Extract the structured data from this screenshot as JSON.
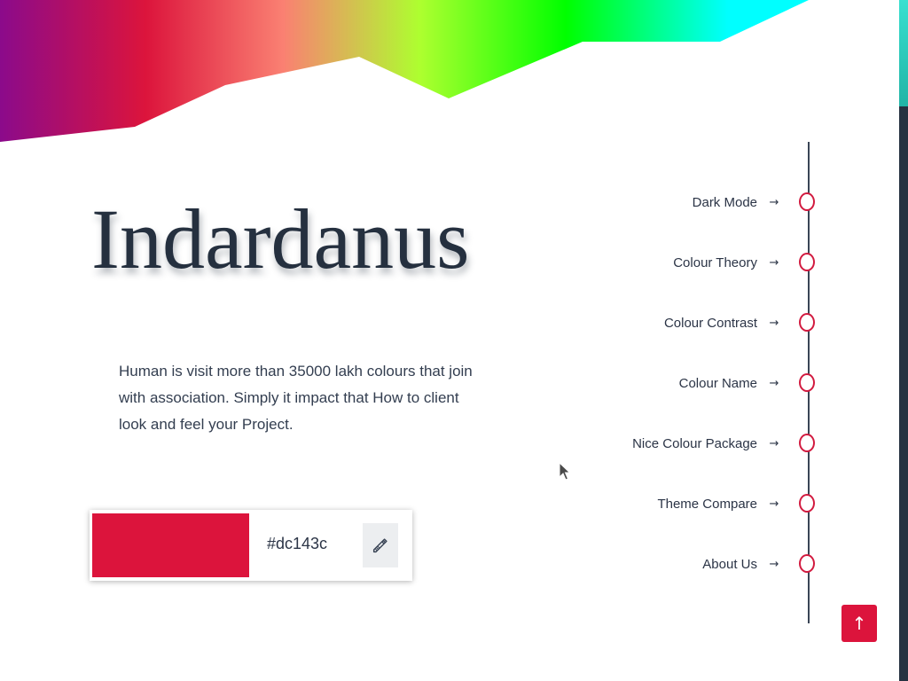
{
  "brand": {
    "title": "Indardanus",
    "description": "Human is visit more than 35000 lakh colours that join with association. Simply it impact that How to client look and feel your Project."
  },
  "colour_picker": {
    "value": "#dc143c",
    "edit_icon": "pencil-icon"
  },
  "nav": {
    "items": [
      {
        "label": "Dark Mode",
        "arrow": "→"
      },
      {
        "label": "Colour Theory",
        "arrow": "→"
      },
      {
        "label": "Colour Contrast",
        "arrow": "→"
      },
      {
        "label": "Colour Name",
        "arrow": "→"
      },
      {
        "label": "Nice Colour Package",
        "arrow": "→"
      },
      {
        "label": "Theme Compare",
        "arrow": "→"
      },
      {
        "label": "About Us",
        "arrow": "→"
      }
    ]
  },
  "back_to_top": {
    "label": "↑"
  },
  "colors": {
    "accent": "#dc143c",
    "text": "#2b3446",
    "timeline_line": "#3a4556",
    "timeline_dot": "#d21a3f",
    "scrollbar_track": "#263241",
    "scrollbar_thumb": "#2ec9b9",
    "banner_gradient": [
      "#8b0a8b",
      "#dc143c",
      "#fa8072",
      "#adff2f",
      "#00ff00",
      "#00ffff"
    ]
  }
}
